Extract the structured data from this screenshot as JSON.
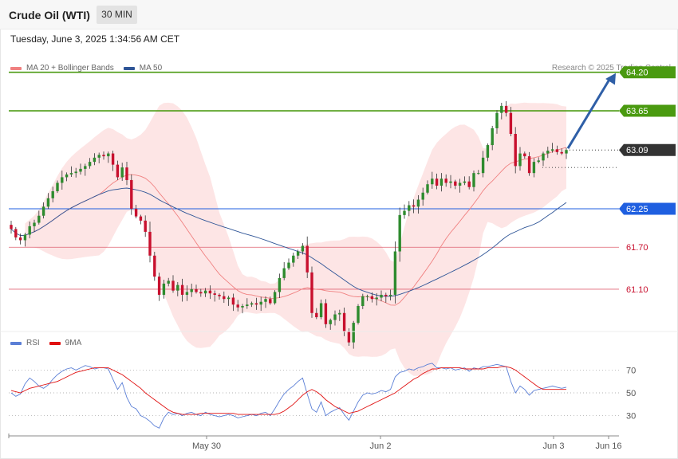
{
  "header": {
    "title": "Crude Oil (WTI)",
    "interval": "30 MIN",
    "datetime": "Tuesday, June 3, 2025 1:34:56 AM CET"
  },
  "legend": {
    "ma20": "MA 20 + Bollinger Bands",
    "ma50": "MA 50",
    "credit": "Research © 2025 Trading Central"
  },
  "rsi_legend": {
    "rsi": "RSI",
    "ma9": "9MA"
  },
  "colors": {
    "bull": "#2e8b2e",
    "bear": "#c8102e",
    "ma20": "#f08080",
    "ma50": "#2f5597",
    "band": "#fde0e0",
    "resistance": "#4a9a10",
    "pivot": "#1f5fe0",
    "support": "#e06070",
    "current": "#333333",
    "arrow": "#2f5fa7",
    "rsi": "#5b7fd6",
    "rsi_ma": "#e01010"
  },
  "chart_data": [
    {
      "type": "candlestick",
      "title": "Crude Oil (WTI)",
      "timeframe": "30 MIN",
      "x_labels": [
        "May 30",
        "Jun 2",
        "Jun 3",
        "Jun 16"
      ],
      "ylim": [
        60.45,
        64.55
      ],
      "levels": [
        {
          "name": "resistance-2",
          "value": 64.2,
          "label": "64.20",
          "style": "resistance"
        },
        {
          "name": "resistance-1",
          "value": 63.65,
          "label": "63.65",
          "style": "resistance"
        },
        {
          "name": "current",
          "value": 63.09,
          "label": "63.09",
          "style": "current"
        },
        {
          "name": "pivot",
          "value": 62.25,
          "label": "62.25",
          "style": "pivot"
        },
        {
          "name": "support-1",
          "value": 61.7,
          "label": "61.70",
          "style": "support"
        },
        {
          "name": "support-2",
          "value": 61.1,
          "label": "61.10",
          "style": "support"
        }
      ],
      "projection": {
        "from": 63.09,
        "to": 64.2
      },
      "closes": [
        61.96,
        61.84,
        61.8,
        61.88,
        62.0,
        62.05,
        62.15,
        62.28,
        62.4,
        62.5,
        62.62,
        62.7,
        62.74,
        62.76,
        62.78,
        62.82,
        62.86,
        62.92,
        62.98,
        63.02,
        63.0,
        63.04,
        62.88,
        62.7,
        62.84,
        62.66,
        62.25,
        62.14,
        62.08,
        61.92,
        61.58,
        61.28,
        61.02,
        61.18,
        61.22,
        61.08,
        61.16,
        61.02,
        61.06,
        61.1,
        61.06,
        61.04,
        61.08,
        61.04,
        61.02,
        61.0,
        60.96,
        60.98,
        60.88,
        60.84,
        60.86,
        60.88,
        60.9,
        60.88,
        60.92,
        60.96,
        60.9,
        61.06,
        61.26,
        61.4,
        61.48,
        61.58,
        61.64,
        61.72,
        61.34,
        60.76,
        60.7,
        60.9,
        60.6,
        60.66,
        60.74,
        60.76,
        60.5,
        60.34,
        60.62,
        60.86,
        61.0,
        61.0,
        60.96,
        60.98,
        61.02,
        61.0,
        61.02,
        61.64,
        62.16,
        62.22,
        62.3,
        62.28,
        62.38,
        62.48,
        62.6,
        62.68,
        62.58,
        62.68,
        62.62,
        62.64,
        62.58,
        62.62,
        62.64,
        62.56,
        62.76,
        62.76,
        62.98,
        63.16,
        63.4,
        63.62,
        63.72,
        63.62,
        63.32,
        62.86,
        63.04,
        63.0,
        62.76,
        62.92,
        62.94,
        63.04,
        63.08,
        63.1,
        63.06,
        63.04,
        63.09
      ],
      "rsi": {
        "ylim": [
          15,
          85
        ],
        "ticks": [
          70,
          50,
          30
        ],
        "rsi_values": [
          50,
          47,
          49,
          58,
          63,
          60,
          56,
          54,
          57,
          62,
          66,
          69,
          71,
          72,
          70,
          72,
          74,
          73,
          71,
          72,
          72,
          71,
          62,
          53,
          59,
          46,
          38,
          36,
          30,
          28,
          25,
          21,
          19,
          28,
          33,
          31,
          32,
          30,
          32,
          33,
          31,
          30,
          33,
          31,
          30,
          29,
          30,
          31,
          30,
          28,
          29,
          30,
          31,
          30,
          32,
          33,
          30,
          36,
          43,
          49,
          53,
          56,
          60,
          63,
          49,
          36,
          33,
          42,
          30,
          33,
          35,
          37,
          31,
          26,
          34,
          42,
          48,
          50,
          49,
          50,
          52,
          51,
          53,
          64,
          68,
          69,
          71,
          70,
          72,
          73,
          75,
          76,
          72,
          72,
          71,
          72,
          70,
          71,
          72,
          69,
          72,
          71,
          73,
          73,
          74,
          75,
          74,
          73,
          60,
          50,
          56,
          53,
          48,
          52,
          53,
          54,
          55,
          56,
          55,
          54,
          55
        ],
        "rsi_ma_values": [
          52,
          51,
          50,
          52,
          54,
          55,
          56,
          57,
          58,
          59,
          60,
          62,
          64,
          66,
          68,
          69,
          70,
          71,
          72,
          72,
          72,
          72,
          70,
          68,
          66,
          63,
          60,
          57,
          54,
          50,
          47,
          44,
          41,
          38,
          35,
          33,
          32,
          31,
          31,
          31,
          31,
          32,
          32,
          32,
          32,
          32,
          32,
          32,
          32,
          31,
          31,
          31,
          31,
          31,
          31,
          31,
          31,
          31,
          32,
          34,
          37,
          40,
          44,
          48,
          51,
          53,
          51,
          48,
          44,
          41,
          38,
          36,
          34,
          32,
          33,
          34,
          36,
          38,
          40,
          42,
          44,
          46,
          48,
          50,
          53,
          56,
          59,
          62,
          64,
          67,
          69,
          71,
          71,
          72,
          72,
          72,
          72,
          72,
          71,
          71,
          71,
          71,
          71,
          72,
          72,
          72,
          73,
          73,
          72,
          70,
          67,
          64,
          61,
          58,
          55,
          53,
          53,
          53,
          53,
          53,
          53
        ]
      }
    }
  ]
}
